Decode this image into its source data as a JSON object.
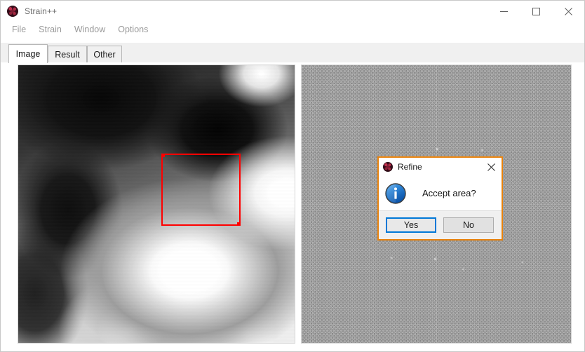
{
  "window": {
    "title": "Strain++",
    "icon": "app-icon",
    "controls": {
      "minimize": "minimize-icon",
      "maximize": "maximize-icon",
      "close": "close-icon"
    }
  },
  "menu": {
    "items": [
      {
        "label": "File"
      },
      {
        "label": "Strain"
      },
      {
        "label": "Window"
      },
      {
        "label": "Options"
      }
    ]
  },
  "tabs": {
    "active": "Image",
    "items": [
      {
        "label": "Image"
      },
      {
        "label": "Result"
      },
      {
        "label": "Other"
      }
    ]
  },
  "panels": {
    "left": {
      "name": "phase-image",
      "description": "grayscale phase map"
    },
    "right": {
      "name": "fft-image",
      "description": "noisy grayscale FFT diffractogram"
    },
    "selection": {
      "name": "selection-rectangle",
      "color": "#ff0000"
    }
  },
  "dialog": {
    "title": "Refine",
    "icon": "app-icon",
    "close_label": "✕",
    "message": "Accept area?",
    "info_icon": "information-icon",
    "buttons": [
      {
        "label": "Yes",
        "default": true
      },
      {
        "label": "No",
        "default": false
      }
    ],
    "border_color": "#e8820c",
    "focus_color": "#0078d7"
  }
}
